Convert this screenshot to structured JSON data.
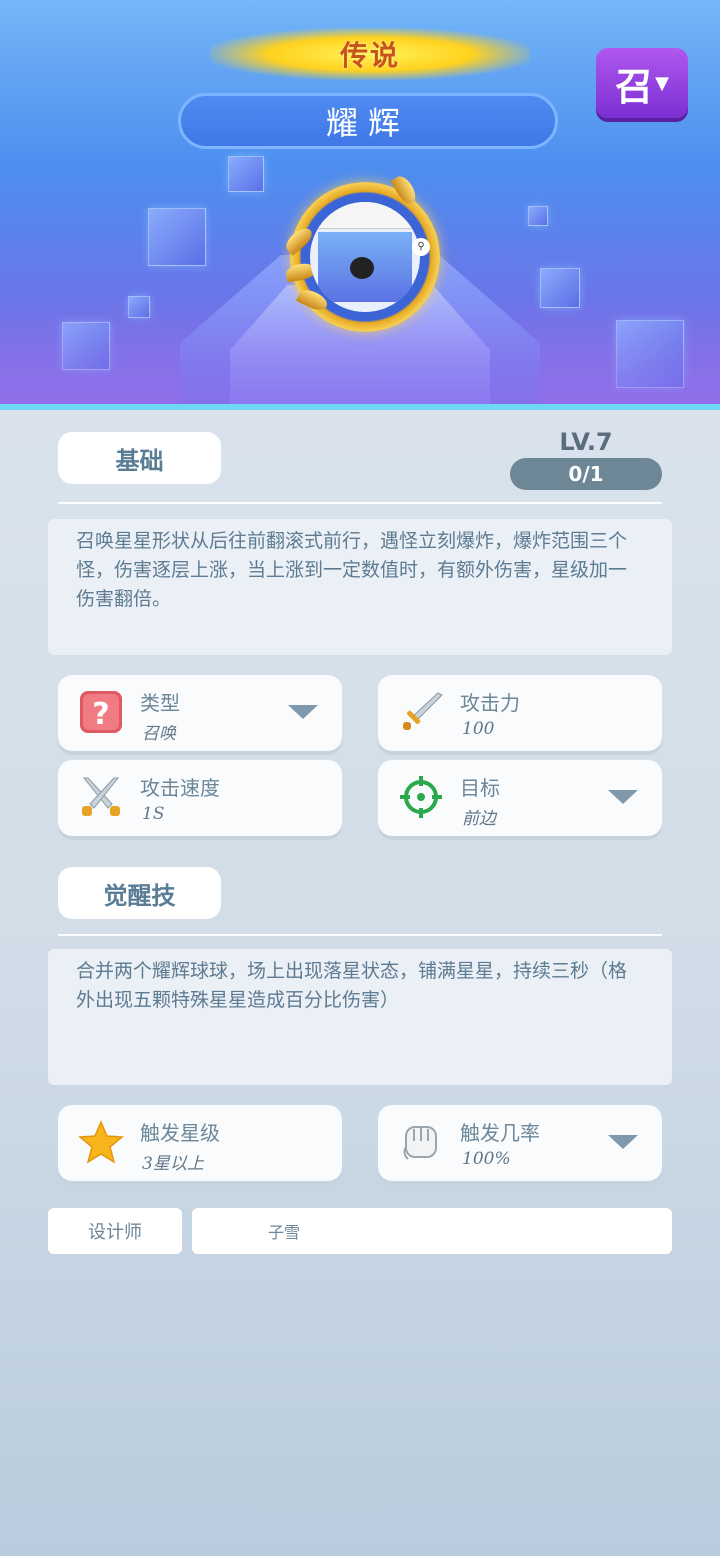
{
  "header": {
    "rarity": "传说",
    "hero_name": "耀辉",
    "summon_button": "召"
  },
  "basic": {
    "tab_label": "基础",
    "level": "LV.7",
    "progress": "0/1",
    "description": "召唤星星形状从后往前翻滚式前行，遇怪立刻爆炸，爆炸范围三个怪，伤害逐层上涨，当上涨到一定数值时，有额外伤害，星级加一伤害翻倍。",
    "stats": [
      {
        "label": "类型",
        "value": "召唤",
        "icon": "question-icon"
      },
      {
        "label": "攻击力",
        "value": "100",
        "icon": "sword-icon"
      },
      {
        "label": "攻击速度",
        "value": "1S",
        "icon": "crossed-swords-icon"
      },
      {
        "label": "目标",
        "value": "前边",
        "icon": "target-icon"
      }
    ]
  },
  "awaken": {
    "tab_label": "觉醒技",
    "description": "合并两个耀辉球球，场上出现落星状态，铺满星星，持续三秒（格外出现五颗特殊星星造成百分比伤害）",
    "stats": [
      {
        "label": "触发星级",
        "value": "3星以上",
        "icon": "star-icon"
      },
      {
        "label": "触发几率",
        "value": "100%",
        "icon": "fist-icon"
      }
    ]
  },
  "designer": {
    "label": "设计师",
    "value": "子雪"
  },
  "colors": {
    "accent_purple": "#8f3fe0",
    "rarity_gold": "#ffd21e",
    "text": "#5e7b92"
  }
}
